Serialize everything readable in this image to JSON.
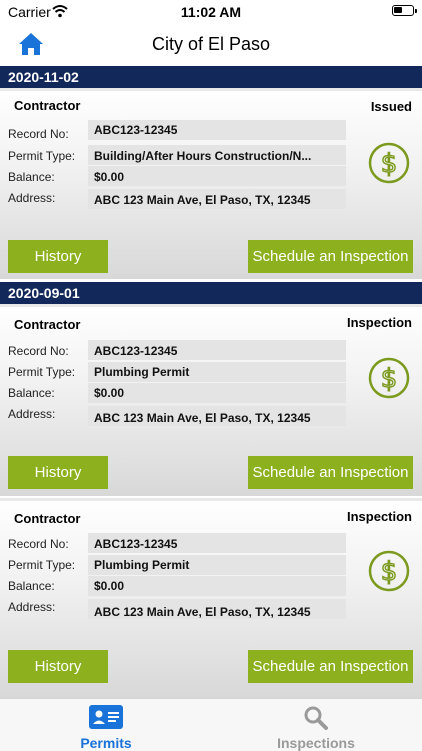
{
  "status_bar": {
    "carrier": "Carrier",
    "time": "11:02 AM"
  },
  "header": {
    "title": "City of El Paso",
    "home_icon": "home-icon"
  },
  "groups": [
    {
      "date": "2020-11-02"
    },
    {
      "date": "2020-09-01"
    }
  ],
  "permits": [
    {
      "contractor": "Contractor",
      "status": "Issued",
      "record_label": "Record No:",
      "record": "ABC123-12345",
      "type_label": "Permit Type:",
      "type": "Building/After Hours Construction/N...",
      "balance_label": "Balance:",
      "balance": "$0.00",
      "address_label": "Address:",
      "address": "ABC 123 Main Ave, El Paso, TX, 12345",
      "history_label": "History",
      "schedule_label": "Schedule an Inspection"
    },
    {
      "contractor": "Contractor",
      "status": "Inspection",
      "record_label": "Record No:",
      "record": "ABC123-12345",
      "type_label": "Permit Type:",
      "type": "Plumbing Permit",
      "balance_label": "Balance:",
      "balance": "$0.00",
      "address_label": "Address:",
      "address": "ABC 123 Main Ave, El Paso, TX, 12345",
      "history_label": "History",
      "schedule_label": "Schedule an Inspection"
    },
    {
      "contractor": "Contractor",
      "status": "Inspection",
      "record_label": "Record No:",
      "record": "ABC123-12345",
      "type_label": "Permit Type:",
      "type": "Plumbing Permit",
      "balance_label": "Balance:",
      "balance": "$0.00",
      "address_label": "Address:",
      "address": "ABC 123 Main Ave, El Paso, TX, 12345",
      "history_label": "History",
      "schedule_label": "Schedule an Inspection"
    }
  ],
  "tabs": [
    {
      "label": "Permits",
      "icon": "id-card-icon",
      "active": true
    },
    {
      "label": "Inspections",
      "icon": "search-icon",
      "active": false
    }
  ],
  "colors": {
    "navy": "#13285a",
    "accent_green": "#8db01f",
    "dollar_green": "#7c9a1e",
    "tab_active": "#1a73d9",
    "tab_inactive": "#9a9a9a"
  }
}
